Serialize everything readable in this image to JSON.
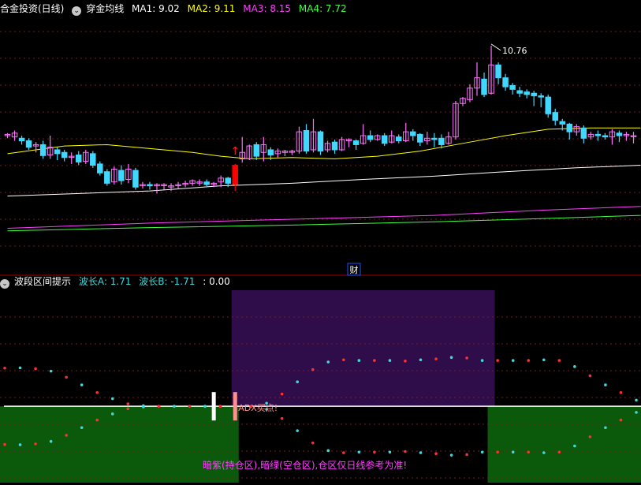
{
  "chart_data": [
    {
      "type": "candlestick",
      "title": "合金投资(日线)",
      "indicator": "穿金均线",
      "ma_labels": [
        {
          "text": "MA1: 9.02",
          "color": "#ffffff"
        },
        {
          "text": "MA2: 9.11",
          "color": "#ffff00"
        },
        {
          "text": "MA3: 8.15",
          "color": "#ff40ff"
        },
        {
          "text": "MA4: 7.72",
          "color": "#40ff40"
        }
      ],
      "ylim": [
        7.3,
        11.2
      ],
      "peak": {
        "index": 68,
        "value": 10.76,
        "label": "10.76"
      },
      "signal": {
        "index": 32,
        "arrow": "↑"
      },
      "candles": [
        [
          9.36,
          9.38,
          9.32,
          9.4
        ],
        [
          9.34,
          9.4,
          9.28,
          9.44
        ],
        [
          9.32,
          9.28,
          9.22,
          9.36
        ],
        [
          9.28,
          9.18,
          9.14,
          9.32
        ],
        [
          9.2,
          9.22,
          9.1,
          9.26
        ],
        [
          9.22,
          9.05,
          9.0,
          9.28
        ],
        [
          9.06,
          9.18,
          9.0,
          9.36
        ],
        [
          9.14,
          9.08,
          8.98,
          9.18
        ],
        [
          9.1,
          9.02,
          8.96,
          9.14
        ],
        [
          9.04,
          9.04,
          8.92,
          9.1
        ],
        [
          9.06,
          8.95,
          8.9,
          9.12
        ],
        [
          8.96,
          9.1,
          8.92,
          9.14
        ],
        [
          9.08,
          8.9,
          8.86,
          9.12
        ],
        [
          8.92,
          8.78,
          8.74,
          8.96
        ],
        [
          8.8,
          8.62,
          8.58,
          8.84
        ],
        [
          8.64,
          8.84,
          8.6,
          8.88
        ],
        [
          8.82,
          8.66,
          8.6,
          8.9
        ],
        [
          8.68,
          8.84,
          8.62,
          8.92
        ],
        [
          8.82,
          8.56,
          8.52,
          8.86
        ],
        [
          8.58,
          8.6,
          8.54,
          8.64
        ],
        [
          8.6,
          8.58,
          8.52,
          8.64
        ],
        [
          8.58,
          8.6,
          8.46,
          8.62
        ],
        [
          8.6,
          8.6,
          8.52,
          8.62
        ],
        [
          8.58,
          8.58,
          8.5,
          8.62
        ],
        [
          8.6,
          8.6,
          8.54,
          8.64
        ],
        [
          8.62,
          8.62,
          8.56,
          8.66
        ],
        [
          8.62,
          8.66,
          8.58,
          8.68
        ],
        [
          8.64,
          8.64,
          8.58,
          8.68
        ],
        [
          8.64,
          8.6,
          8.56,
          8.68
        ],
        [
          8.6,
          8.62,
          8.56,
          8.64
        ],
        [
          8.64,
          8.7,
          8.56,
          8.74
        ],
        [
          8.7,
          8.62,
          8.56,
          8.72
        ],
        [
          8.6,
          8.9,
          8.5,
          8.92
        ],
        [
          9.0,
          9.1,
          8.94,
          9.34
        ],
        [
          9.0,
          9.2,
          8.98,
          9.22
        ],
        [
          9.22,
          9.04,
          8.98,
          9.26
        ],
        [
          9.1,
          9.22,
          8.96,
          9.34
        ],
        [
          9.14,
          9.06,
          8.98,
          9.18
        ],
        [
          9.08,
          9.12,
          9.02,
          9.16
        ],
        [
          9.1,
          9.12,
          9.04,
          9.14
        ],
        [
          9.12,
          9.12,
          9.06,
          9.14
        ],
        [
          9.12,
          9.42,
          9.08,
          9.5
        ],
        [
          9.44,
          9.12,
          9.08,
          9.54
        ],
        [
          9.14,
          9.42,
          9.1,
          9.62
        ],
        [
          9.42,
          9.12,
          9.06,
          9.44
        ],
        [
          9.14,
          9.24,
          9.1,
          9.28
        ],
        [
          9.26,
          9.14,
          9.08,
          9.3
        ],
        [
          9.14,
          9.3,
          9.12,
          9.34
        ],
        [
          9.28,
          9.3,
          9.18,
          9.32
        ],
        [
          9.28,
          9.22,
          9.14,
          9.3
        ],
        [
          9.24,
          9.36,
          9.22,
          9.54
        ],
        [
          9.36,
          9.3,
          9.26,
          9.44
        ],
        [
          9.3,
          9.36,
          9.28,
          9.38
        ],
        [
          9.36,
          9.24,
          9.2,
          9.4
        ],
        [
          9.26,
          9.36,
          9.24,
          9.44
        ],
        [
          9.34,
          9.28,
          9.24,
          9.38
        ],
        [
          9.28,
          9.42,
          9.26,
          9.56
        ],
        [
          9.42,
          9.36,
          9.28,
          9.46
        ],
        [
          9.38,
          9.26,
          9.2,
          9.4
        ],
        [
          9.28,
          9.32,
          9.22,
          9.42
        ],
        [
          9.32,
          9.3,
          9.18,
          9.4
        ],
        [
          9.32,
          9.22,
          9.16,
          9.38
        ],
        [
          9.24,
          9.34,
          9.22,
          9.42
        ],
        [
          9.34,
          9.86,
          9.3,
          9.9
        ],
        [
          9.86,
          9.94,
          9.82,
          9.96
        ],
        [
          9.92,
          10.1,
          9.88,
          10.16
        ],
        [
          10.1,
          10.26,
          9.98,
          10.5
        ],
        [
          10.24,
          10.0,
          9.96,
          10.34
        ],
        [
          10.02,
          10.46,
          10.0,
          10.76
        ],
        [
          10.46,
          10.26,
          10.16,
          10.5
        ],
        [
          10.26,
          10.12,
          10.06,
          10.32
        ],
        [
          10.14,
          10.08,
          10.0,
          10.18
        ],
        [
          10.06,
          10.02,
          9.96,
          10.12
        ],
        [
          10.04,
          10.0,
          9.94,
          10.08
        ],
        [
          10.02,
          9.98,
          9.82,
          10.06
        ],
        [
          9.98,
          9.96,
          9.8,
          10.02
        ],
        [
          9.96,
          9.7,
          9.64,
          10.0
        ],
        [
          9.72,
          9.6,
          9.52,
          9.78
        ],
        [
          9.58,
          9.54,
          9.44,
          9.62
        ],
        [
          9.54,
          9.42,
          9.3,
          9.56
        ],
        [
          9.42,
          9.5,
          9.36,
          9.54
        ],
        [
          9.48,
          9.32,
          9.24,
          9.52
        ],
        [
          9.34,
          9.38,
          9.3,
          9.42
        ],
        [
          9.38,
          9.36,
          9.28,
          9.44
        ],
        [
          9.36,
          9.34,
          9.3,
          9.4
        ],
        [
          9.34,
          9.42,
          9.22,
          9.46
        ],
        [
          9.4,
          9.36,
          9.26,
          9.44
        ],
        [
          9.36,
          9.38,
          9.28,
          9.42
        ],
        [
          9.36,
          9.36,
          9.24,
          9.42
        ]
      ],
      "ma_lines": [
        {
          "name": "MA1",
          "color": "#ffffff",
          "points": [
            [
              0,
              8.42
            ],
            [
              20,
              8.5
            ],
            [
              30,
              8.58
            ],
            [
              40,
              8.62
            ],
            [
              50,
              8.68
            ],
            [
              60,
              8.73
            ],
            [
              70,
              8.8
            ],
            [
              80,
              8.86
            ],
            [
              89,
              8.9
            ]
          ]
        },
        {
          "name": "MA2",
          "color": "#ffff00",
          "points": [
            [
              0,
              9.08
            ],
            [
              8,
              9.2
            ],
            [
              14,
              9.22
            ],
            [
              20,
              9.16
            ],
            [
              26,
              9.1
            ],
            [
              30,
              9.04
            ],
            [
              34,
              9.0
            ],
            [
              40,
              9.02
            ],
            [
              46,
              9.0
            ],
            [
              52,
              9.04
            ],
            [
              58,
              9.12
            ],
            [
              64,
              9.24
            ],
            [
              70,
              9.36
            ],
            [
              76,
              9.46
            ],
            [
              82,
              9.48
            ],
            [
              89,
              9.48
            ]
          ]
        },
        {
          "name": "MA3",
          "color": "#ff40ff",
          "points": [
            [
              0,
              7.92
            ],
            [
              20,
              8.0
            ],
            [
              40,
              8.06
            ],
            [
              60,
              8.12
            ],
            [
              75,
              8.2
            ],
            [
              89,
              8.26
            ]
          ]
        },
        {
          "name": "MA4",
          "color": "#40ff40",
          "points": [
            [
              0,
              7.88
            ],
            [
              20,
              7.93
            ],
            [
              40,
              7.97
            ],
            [
              60,
              8.02
            ],
            [
              75,
              8.07
            ],
            [
              89,
              8.12
            ]
          ]
        }
      ],
      "cai_label": "财"
    },
    {
      "type": "area",
      "title": "波段区间提示",
      "labels": [
        {
          "text": "波长A: 1.71",
          "color": "#40d8d8"
        },
        {
          "text": "波长B: -1.71",
          "color": "#40d8d8"
        },
        {
          "text": ": 0.00",
          "color": "#ffffff"
        }
      ],
      "ylim": [
        -2.5,
        3.8
      ],
      "zero_line": 0,
      "zones": [
        {
          "kind": "空仓区",
          "color": "#0b5a0b",
          "start": 0,
          "end": 32
        },
        {
          "kind": "持仓区",
          "color": "#2e0d4a",
          "start": 32,
          "end": 68
        },
        {
          "kind": "空仓区",
          "color": "#0b5a0b",
          "start": 68,
          "end": 89
        }
      ],
      "dots_a": [
        1.25,
        1.26,
        1.23,
        1.15,
        0.95,
        0.7,
        0.45,
        0.25,
        0.08,
        0.02,
        0.0,
        0.0,
        0.0,
        0.0,
        0.0,
        0.0,
        0.0,
        0.1,
        0.4,
        0.8,
        1.2,
        1.45,
        1.52,
        1.5,
        1.5,
        1.5,
        1.48,
        1.52,
        1.55,
        1.6,
        1.58,
        1.5,
        1.5,
        1.5,
        1.5,
        1.52,
        1.5,
        1.3,
        1.0,
        0.7,
        0.45,
        0.2
      ],
      "dots_b": [
        -1.25,
        -1.26,
        -1.23,
        -1.15,
        -0.95,
        -0.7,
        -0.45,
        -0.25,
        -0.08,
        -0.02,
        0.0,
        0.0,
        0.0,
        0.0,
        0.0,
        0.0,
        0.0,
        -0.1,
        -0.4,
        -0.8,
        -1.2,
        -1.45,
        -1.52,
        -1.5,
        -1.5,
        -1.5,
        -1.48,
        -1.52,
        -1.55,
        -1.6,
        -1.58,
        -1.5,
        -1.5,
        -1.5,
        -1.5,
        -1.52,
        -1.5,
        -1.3,
        -1.0,
        -0.7,
        -0.45,
        -0.2
      ],
      "signals": [
        {
          "index": 29,
          "color": "#ffffff",
          "label": ""
        },
        {
          "index": 32,
          "color": "#ff9090",
          "label": "ADX买点!"
        }
      ],
      "note": "暗紫(持仓区),暗绿(空仓区),仓区仅日线参考为准!"
    }
  ],
  "colors": {
    "up": "#ff70ff",
    "down": "#40d8ff",
    "red_candle": "#ff0000",
    "grid": "#7a1a1a",
    "axis": "#a00000"
  }
}
